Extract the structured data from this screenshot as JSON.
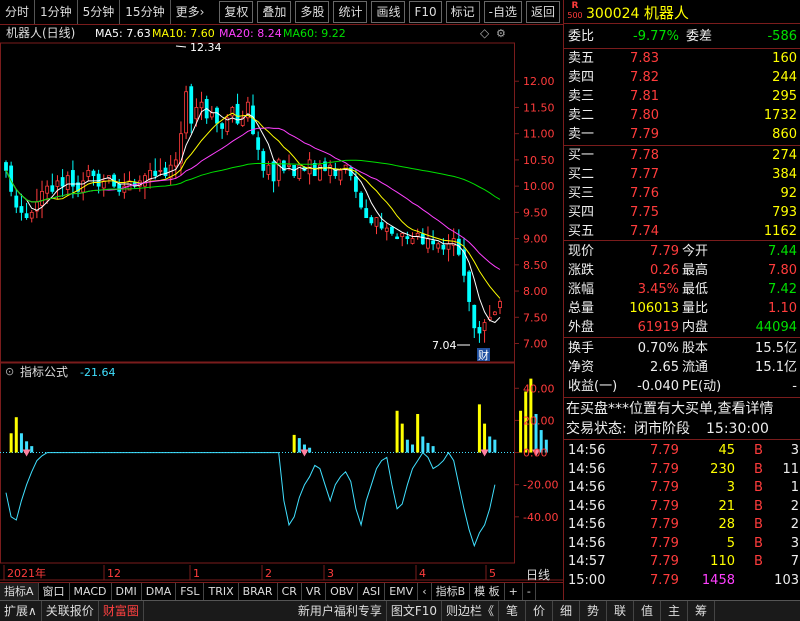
{
  "toolbar": {
    "periods": [
      "分时",
      "1分钟",
      "5分钟",
      "15分钟",
      "更多›"
    ],
    "tools": [
      "复权",
      "叠加",
      "多股",
      "统计",
      "画线",
      "F10",
      "标记",
      "-自选",
      "返回"
    ]
  },
  "chart": {
    "stock_title": "机器人(日线)",
    "ma5_label": "MA5: 7.63",
    "ma10_label": "MA10: 7.60",
    "ma20_label": "MA20: 8.24",
    "ma60_label": "MA60: 9.22",
    "high_marker": "12.34",
    "low_marker": "7.04",
    "cai_badge": "财",
    "price_ticks": [
      "12.00",
      "11.50",
      "11.00",
      "10.50",
      "10.00",
      "9.50",
      "9.00",
      "8.50",
      "8.00",
      "7.50",
      "7.00"
    ],
    "indicator_title": "指标公式",
    "indicator_value": "-21.64",
    "indicator_ticks": [
      "40.00",
      "20.00",
      "0.00",
      "-20.00",
      "-40.00"
    ],
    "date_labels": [
      "2021年",
      "12",
      "1",
      "2",
      "3",
      "4",
      "5"
    ],
    "period_label": "日线",
    "colors": {
      "ma5": "#ffffff",
      "ma10": "#ffff00",
      "ma20": "#ff40ff",
      "ma60": "#00e000",
      "up": "#ff3c3c",
      "down": "#00ffff",
      "grid": "#7a1c1c"
    }
  },
  "chart_data": {
    "type": "candlestick",
    "title": "机器人(日线)",
    "ma": {
      "MA5": 7.63,
      "MA10": 7.6,
      "MA20": 8.24,
      "MA60": 9.22
    },
    "high": 12.34,
    "low": 7.04,
    "ylim": [
      6.8,
      12.5
    ],
    "closes": [
      10.3,
      9.9,
      9.6,
      9.5,
      9.4,
      9.5,
      9.7,
      9.9,
      10.0,
      9.9,
      10.1,
      10.0,
      10.2,
      10.0,
      9.9,
      10.1,
      10.3,
      10.2,
      10.0,
      10.1,
      10.2,
      10.0,
      9.9,
      10.0,
      10.1,
      10.0,
      10.1,
      10.2,
      10.3,
      10.2,
      10.3,
      10.2,
      10.4,
      10.5,
      11.0,
      11.8,
      11.2,
      11.5,
      11.6,
      11.3,
      11.4,
      11.2,
      11.1,
      11.3,
      11.5,
      11.2,
      11.3,
      11.6,
      11.0,
      10.7,
      10.3,
      10.4,
      10.1,
      10.5,
      10.3,
      10.4,
      10.2,
      10.4,
      10.3,
      10.5,
      10.2,
      10.4,
      10.3,
      10.4,
      10.2,
      10.3,
      10.4,
      10.2,
      9.9,
      9.6,
      9.4,
      9.3,
      9.4,
      9.2,
      9.2,
      9.1,
      9.0,
      9.1,
      9.0,
      9.0,
      9.1,
      8.9,
      9.0,
      8.9,
      8.9,
      8.8,
      8.9,
      9.0,
      8.7,
      8.3,
      7.8,
      7.3,
      7.2,
      7.4,
      7.5,
      7.6,
      7.8
    ],
    "indicator": {
      "name": "指标公式",
      "last": -21.64,
      "ylim": [
        -65,
        52
      ],
      "line": [
        -25,
        -40,
        -42,
        -30,
        -20,
        -12,
        -5,
        -2,
        0,
        0,
        0,
        0,
        0,
        0,
        0,
        0,
        0,
        0,
        0,
        0,
        0,
        0,
        0,
        0,
        0,
        0,
        0,
        0,
        0,
        0,
        0,
        0,
        0,
        0,
        0,
        0,
        0,
        0,
        0,
        0,
        0,
        0,
        0,
        0,
        0,
        0,
        0,
        0,
        0,
        0,
        0,
        0,
        0,
        0,
        -30,
        -45,
        -40,
        -28,
        -20,
        -15,
        -8,
        -10,
        -20,
        -30,
        -20,
        -15,
        -12,
        -18,
        -35,
        -45,
        -30,
        -20,
        -10,
        -5,
        -3,
        -20,
        -35,
        -32,
        -20,
        -10,
        -5,
        0,
        -3,
        -10,
        -8,
        -5,
        0,
        -5,
        -20,
        -35,
        -48,
        -58,
        -50,
        -45,
        -35,
        -20
      ],
      "bars": [
        {
          "i": 1,
          "v": 12,
          "c": "yel"
        },
        {
          "i": 2,
          "v": 22,
          "c": "yel"
        },
        {
          "i": 3,
          "v": 12,
          "c": "cyan"
        },
        {
          "i": 4,
          "v": 7,
          "c": "cyan"
        },
        {
          "i": 5,
          "v": 4,
          "c": "cyan"
        },
        {
          "i": 56,
          "v": 11,
          "c": "yel"
        },
        {
          "i": 57,
          "v": 9,
          "c": "cyan"
        },
        {
          "i": 58,
          "v": 5,
          "c": "cyan"
        },
        {
          "i": 59,
          "v": 3,
          "c": "cyan"
        },
        {
          "i": 76,
          "v": 26,
          "c": "yel"
        },
        {
          "i": 77,
          "v": 18,
          "c": "yel"
        },
        {
          "i": 78,
          "v": 8,
          "c": "cyan"
        },
        {
          "i": 79,
          "v": 5,
          "c": "cyan"
        },
        {
          "i": 80,
          "v": 24,
          "c": "yel"
        },
        {
          "i": 81,
          "v": 10,
          "c": "cyan"
        },
        {
          "i": 82,
          "v": 6,
          "c": "cyan"
        },
        {
          "i": 83,
          "v": 4,
          "c": "cyan"
        },
        {
          "i": 92,
          "v": 30,
          "c": "yel"
        },
        {
          "i": 93,
          "v": 18,
          "c": "yel"
        },
        {
          "i": 94,
          "v": 10,
          "c": "cyan"
        },
        {
          "i": 95,
          "v": 8,
          "c": "cyan"
        },
        {
          "i": 100,
          "v": 26,
          "c": "yel"
        },
        {
          "i": 101,
          "v": 38,
          "c": "yel"
        },
        {
          "i": 102,
          "v": 46,
          "c": "yel"
        },
        {
          "i": 103,
          "v": 24,
          "c": "cyan"
        },
        {
          "i": 104,
          "v": 14,
          "c": "cyan"
        },
        {
          "i": 105,
          "v": 8,
          "c": "cyan"
        }
      ]
    }
  },
  "tabs": [
    "指标A",
    "窗口",
    "MACD",
    "DMI",
    "DMA",
    "FSL",
    "TRIX",
    "BRAR",
    "CR",
    "VR",
    "OBV",
    "ASI",
    "EMV",
    "‹",
    "指标B",
    "模 板",
    "+",
    "-"
  ],
  "bottom": [
    "扩展∧",
    "关联报价",
    "财富圈",
    "新用户福利专享",
    "图文F10",
    "则边栏《",
    "笔",
    "价",
    "细",
    "势",
    "联",
    "值",
    "主",
    "筹"
  ],
  "panel": {
    "r_badge": "R",
    "r_sub": "500",
    "code": "300024",
    "name": "机器人",
    "weibi_label": "委比",
    "weibi": "-9.77%",
    "weicha_label": "委差",
    "weicha": "-586",
    "asks": [
      {
        "label": "卖五",
        "price": "7.83",
        "vol": "160"
      },
      {
        "label": "卖四",
        "price": "7.82",
        "vol": "244"
      },
      {
        "label": "卖三",
        "price": "7.81",
        "vol": "295"
      },
      {
        "label": "卖二",
        "price": "7.80",
        "vol": "1732"
      },
      {
        "label": "卖一",
        "price": "7.79",
        "vol": "860"
      }
    ],
    "bids": [
      {
        "label": "买一",
        "price": "7.78",
        "vol": "274"
      },
      {
        "label": "买二",
        "price": "7.77",
        "vol": "384"
      },
      {
        "label": "买三",
        "price": "7.76",
        "vol": "92"
      },
      {
        "label": "买四",
        "price": "7.75",
        "vol": "793"
      },
      {
        "label": "买五",
        "price": "7.74",
        "vol": "1162"
      }
    ],
    "quote": [
      {
        "l1": "现价",
        "v1": "7.79",
        "c1": "red",
        "l2": "今开",
        "v2": "7.44",
        "c2": "grn"
      },
      {
        "l1": "涨跌",
        "v1": "0.26",
        "c1": "red",
        "l2": "最高",
        "v2": "7.80",
        "c2": "red"
      },
      {
        "l1": "涨幅",
        "v1": "3.45%",
        "c1": "red",
        "l2": "最低",
        "v2": "7.42",
        "c2": "grn"
      },
      {
        "l1": "总量",
        "v1": "106013",
        "c1": "yel",
        "l2": "量比",
        "v2": "1.10",
        "c2": "red"
      },
      {
        "l1": "外盘",
        "v1": "61919",
        "c1": "red",
        "l2": "内盘",
        "v2": "44094",
        "c2": "grn"
      }
    ],
    "quote2": [
      {
        "l1": "换手",
        "v1": "0.70%",
        "l2": "股本",
        "v2": "15.5亿"
      },
      {
        "l1": "净资",
        "v1": "2.65",
        "l2": "流通",
        "v2": "15.1亿"
      },
      {
        "l1": "收益(一)",
        "v1": "-0.040",
        "l2": "PE(动)",
        "v2": "-"
      }
    ],
    "notice": "在买盘***位置有大买单,查看详情",
    "status_label": "交易状态:",
    "status": "闭市阶段",
    "status_time": "15:30:00",
    "ticks": [
      {
        "t": "14:56",
        "p": "7.79",
        "v": "45",
        "bs": "B",
        "n": "3",
        "vc": "yel"
      },
      {
        "t": "14:56",
        "p": "7.79",
        "v": "230",
        "bs": "B",
        "n": "11",
        "vc": "yel"
      },
      {
        "t": "14:56",
        "p": "7.79",
        "v": "3",
        "bs": "B",
        "n": "1",
        "vc": "yel"
      },
      {
        "t": "14:56",
        "p": "7.79",
        "v": "21",
        "bs": "B",
        "n": "2",
        "vc": "yel"
      },
      {
        "t": "14:56",
        "p": "7.79",
        "v": "28",
        "bs": "B",
        "n": "2",
        "vc": "yel"
      },
      {
        "t": "14:56",
        "p": "7.79",
        "v": "5",
        "bs": "B",
        "n": "3",
        "vc": "yel"
      },
      {
        "t": "14:57",
        "p": "7.79",
        "v": "110",
        "bs": "B",
        "n": "7",
        "vc": "yel"
      },
      {
        "t": "15:00",
        "p": "7.79",
        "v": "1458",
        "bs": "",
        "n": "103",
        "vc": "mag"
      }
    ]
  }
}
